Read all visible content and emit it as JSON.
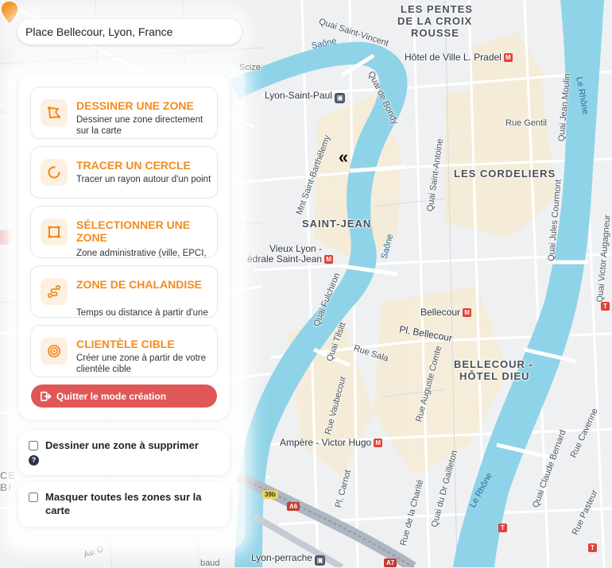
{
  "search": {
    "value": "Place Bellecour, Lyon, France"
  },
  "tools": [
    {
      "title": "DESSINER UNE ZONE",
      "description": "Dessiner une zone directement sur la carte",
      "icon": "polygon-draw-icon"
    },
    {
      "title": "TRACER UN CERCLE",
      "description": "Tracer un rayon autour d'un point",
      "icon": "circle-icon"
    },
    {
      "title": "SÉLECTIONNER UNE ZONE",
      "description": "Zone administrative (ville, EPCI, IRIS...)",
      "icon": "select-area-icon"
    },
    {
      "title": "ZONE DE CHALANDISE",
      "description": "Temps ou distance à partir d'une adresse",
      "icon": "route-icon"
    },
    {
      "title": "CLIENTÈLE CIBLE",
      "description": "Créer une zone à partir de votre clientèle cible",
      "icon": "target-icon"
    }
  ],
  "quit_button": {
    "label": "Quitter le mode création"
  },
  "options": {
    "delete_zone": {
      "label": "Dessiner une zone à supprimer",
      "checked": false,
      "help": "?"
    },
    "hide_zones": {
      "label": "Masquer toutes les zones sur la carte",
      "checked": false
    }
  },
  "map": {
    "collapse_icon": "«",
    "districts": [
      "LES PENTES",
      "DE LA CROIX",
      "ROUSSE",
      "LES CORDELIERS",
      "SAINT-JEAN",
      "BELLECOUR -",
      "HÔTEL DIEU"
    ],
    "pois": {
      "hotel_de_ville": "Hôtel de Ville L. Pradel",
      "lyon_saint_paul": "Lyon-Saint-Paul",
      "vieux_lyon_1": "Vieux Lyon -",
      "vieux_lyon_2": "édrale Saint-Jean",
      "bellecour": "Bellecour",
      "ampere": "Ampère - Victor Hugo",
      "perrache": "Lyon-perrache"
    },
    "streets": {
      "quai_st_vincent": "Quai Saint-Vincent",
      "quai_bondy": "Quai de Bondy",
      "scize": "Scize",
      "quai_jean_moulin": "Quai Jean Moulin",
      "rue_gentil": "Rue Gentil",
      "mnt_st_barth": "Mnt Saint-Barthélemy",
      "quai_st_antoine": "Quai Saint-Antoine",
      "quai_jules_courmont": "Quai Jules Courmont",
      "quai_victor_augagneur": "Quai Victor Augagneur",
      "quai_fulchiron": "Quai Fulchiron",
      "quai_tilsitt": "Quai Tilsitt",
      "pl_bellecour": "Pl. Bellecour",
      "rue_sala": "Rue Sala",
      "rue_auguste_comte": "Rue Auguste Comte",
      "rue_vaubecour": "Rue Vaubecour",
      "quai_dr_gailleton": "Quai du Dr Gailleton",
      "quai_claude_bernard": "Quai Claude Bernard",
      "rue_cavenne": "Rue Cavenne",
      "rue_pasteur": "Rue Pasteur",
      "rue_charite": "Rue de la Charité",
      "carnot": "Pl. Carnot"
    },
    "water": {
      "saone1": "Saône",
      "saone2": "Saône",
      "rhone1": "Le Rhône",
      "rhone2": "Le Rhône"
    },
    "metro_glyph": "M",
    "tram_glyph": "T",
    "rail_glyph": "▣",
    "roads": {
      "a6": "A6",
      "a7": "A7",
      "n39b": "39b"
    },
    "left_edge_fragments": [
      "CE",
      "BI",
      "Av. D"
    ],
    "bottom_fragments": [
      "baud"
    ]
  }
}
